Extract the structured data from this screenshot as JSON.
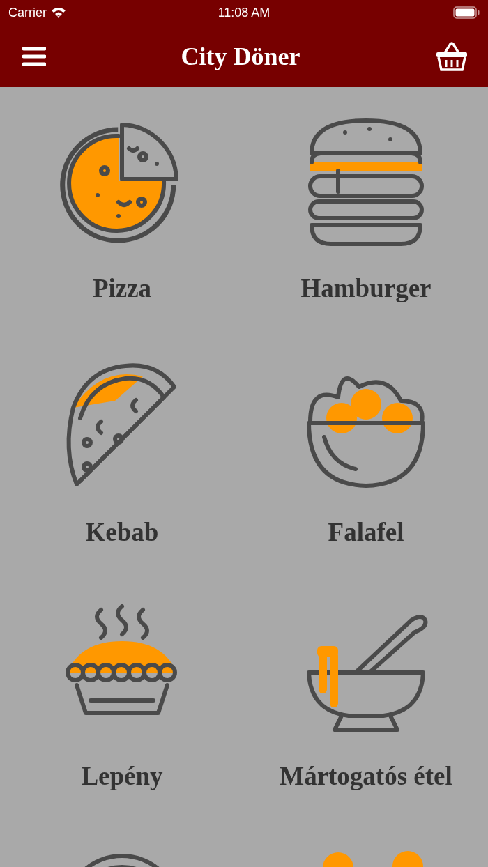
{
  "status_bar": {
    "carrier": "Carrier",
    "time": "11:08 AM"
  },
  "nav_bar": {
    "title": "City Döner"
  },
  "categories": [
    {
      "kind": "pizza",
      "label": "Pizza"
    },
    {
      "kind": "burger",
      "label": "Hamburger"
    },
    {
      "kind": "taco",
      "label": "Kebab"
    },
    {
      "kind": "bowl",
      "label": "Falafel"
    },
    {
      "kind": "pie",
      "label": "Lepény"
    },
    {
      "kind": "soup",
      "label": "Mártogatós étel"
    },
    {
      "kind": "dome"
    },
    {
      "kind": "blobs"
    }
  ]
}
